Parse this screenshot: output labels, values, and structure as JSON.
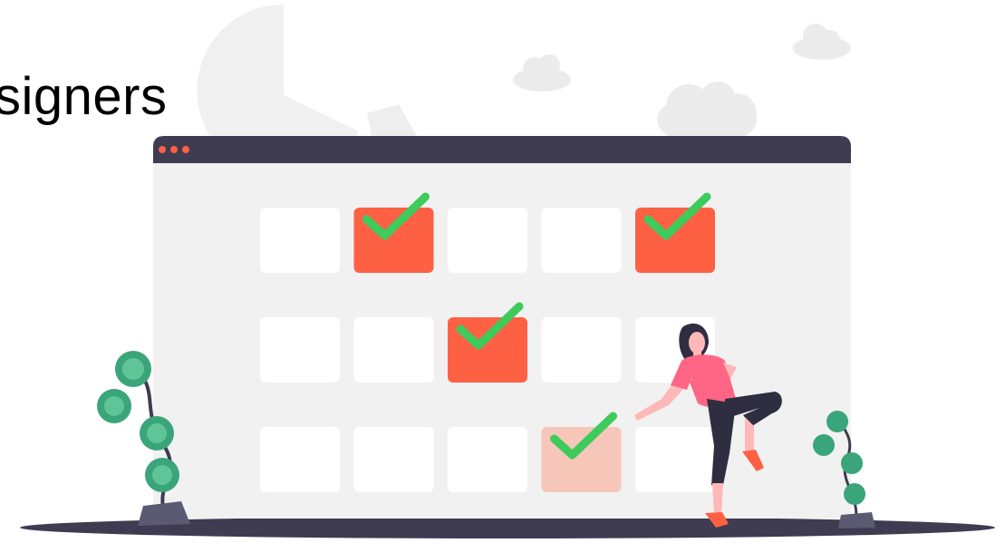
{
  "heading": {
    "text": "signers"
  },
  "colors": {
    "accent": "#fe6044",
    "accent_light": "#f6c7b9",
    "check": "#3ecb5c",
    "frame_bar": "#3f3b50",
    "window_bg": "#f1f1f1",
    "cell": "#ffffff",
    "plant": "#3aa57a",
    "background_shape": "#f0f0f0"
  },
  "calendar": {
    "rows": [
      [
        {
          "state": "empty"
        },
        {
          "state": "checked"
        },
        {
          "state": "empty"
        },
        {
          "state": "empty"
        },
        {
          "state": "checked"
        }
      ],
      [
        {
          "state": "empty"
        },
        {
          "state": "empty"
        },
        {
          "state": "checked"
        },
        {
          "state": "empty"
        },
        {
          "state": "empty"
        }
      ],
      [
        {
          "state": "empty"
        },
        {
          "state": "empty"
        },
        {
          "state": "empty"
        },
        {
          "state": "pending"
        },
        {
          "state": "empty"
        }
      ]
    ]
  },
  "icons": {
    "window_dots": "three-dots-icon",
    "check": "check-icon",
    "person": "woman-illustration",
    "plant": "plant-icon",
    "cloud": "cloud-icon"
  }
}
